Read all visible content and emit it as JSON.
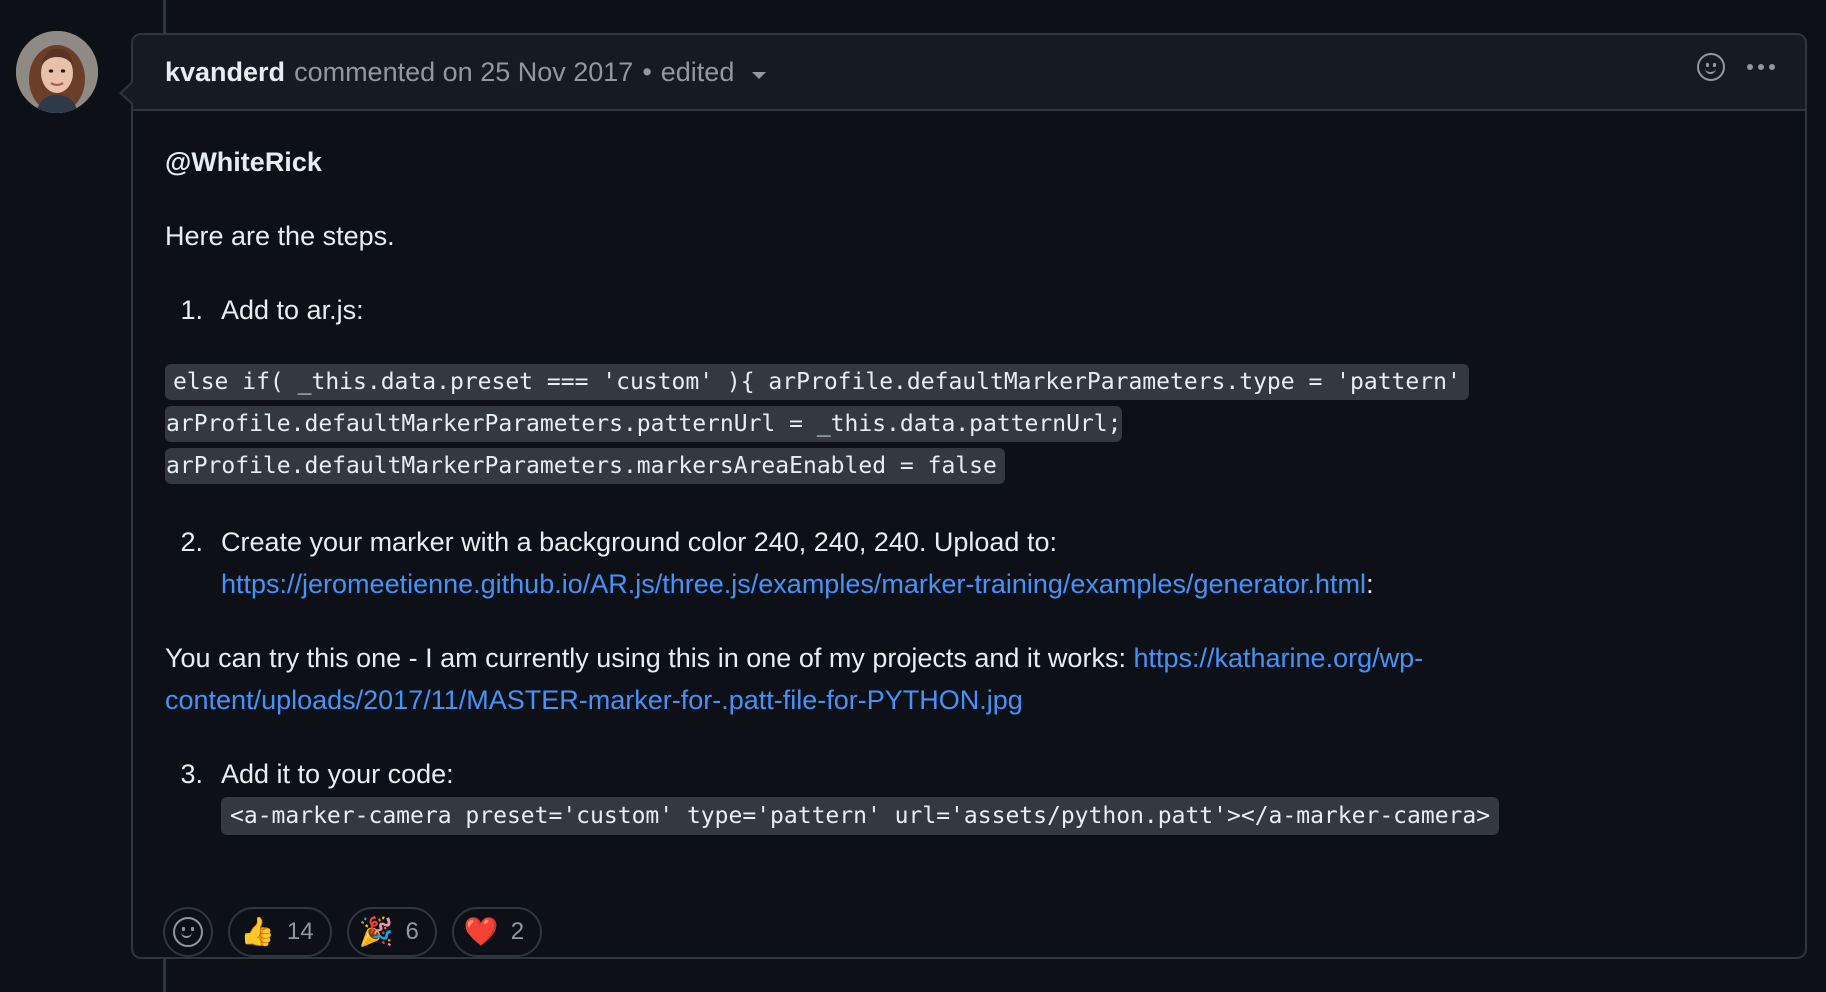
{
  "comment": {
    "author": "kvanderd",
    "action": "commented on",
    "date": "25 Nov 2017",
    "separator": "•",
    "edited": "edited"
  },
  "body": {
    "mention": "@WhiteRick",
    "intro": "Here are the steps.",
    "step1": {
      "num": "1.",
      "text": "Add to ar.js:"
    },
    "code_lines": [
      "else if( _this.data.preset === 'custom' ){ arProfile.defaultMarkerParameters.type = 'pattern'",
      "arProfile.defaultMarkerParameters.patternUrl = _this.data.patternUrl;",
      "arProfile.defaultMarkerParameters.markersAreaEnabled = false"
    ],
    "step2": {
      "num": "2.",
      "text": "Create your marker with a background color 240, 240, 240. Upload to:",
      "link": "https://jeromeetienne.github.io/AR.js/three.js/examples/marker-training/examples/generator.html",
      "trailing": ":"
    },
    "try_text": "You can try this one - I am currently using this in one of my projects and it works: ",
    "try_link_part1": "https://katharine.org/wp-",
    "try_link_part2": "content/uploads/2017/11/MASTER-marker-for-.patt-file-for-PYTHON.jpg",
    "step3": {
      "num": "3.",
      "text": "Add it to your code:",
      "code": "<a-marker-camera preset='custom' type='pattern' url='assets/python.patt'></a-marker-camera>"
    }
  },
  "reactions": [
    {
      "emoji": "👍",
      "count": "14",
      "icon": "thumbs-up-icon"
    },
    {
      "emoji": "🎉",
      "count": "6",
      "icon": "party-popper-icon"
    },
    {
      "emoji": "❤️",
      "count": "2",
      "icon": "heart-icon"
    }
  ],
  "colors": {
    "background": "#0d1117",
    "header": "#161b22",
    "border": "#30363d",
    "link": "#4493f8",
    "muted": "#9198a1",
    "code_bg": "#343941"
  }
}
